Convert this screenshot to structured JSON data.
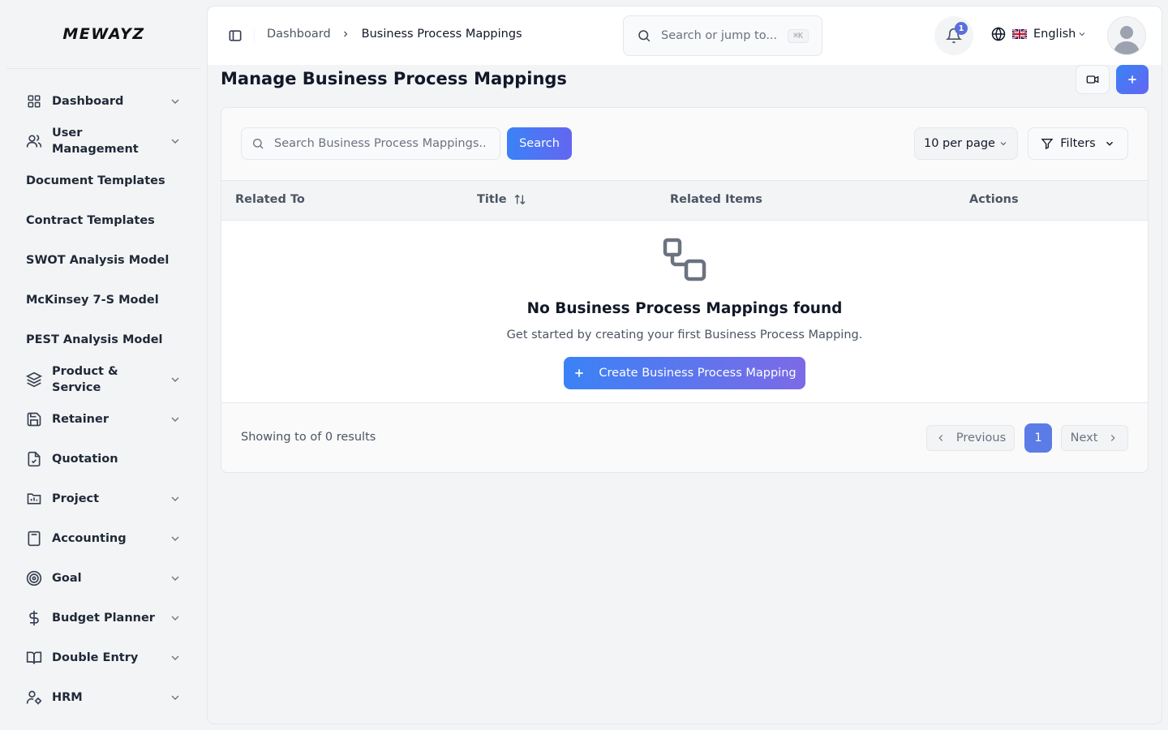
{
  "brand": {
    "logo_text": "MEWAYZ"
  },
  "sidebar": {
    "items": [
      {
        "label": "Dashboard",
        "icon": "grid-icon",
        "expandable": true
      },
      {
        "label": "User Management",
        "icon": "users-icon",
        "expandable": true
      },
      {
        "label": "Document Templates",
        "icon": "",
        "expandable": false
      },
      {
        "label": "Contract Templates",
        "icon": "",
        "expandable": false
      },
      {
        "label": "SWOT Analysis Model",
        "icon": "",
        "expandable": false
      },
      {
        "label": "McKinsey 7-S Model",
        "icon": "",
        "expandable": false
      },
      {
        "label": "PEST Analysis Model",
        "icon": "",
        "expandable": false
      },
      {
        "label": "Product & Service",
        "icon": "layers-icon",
        "expandable": true
      },
      {
        "label": "Retainer",
        "icon": "save-icon",
        "expandable": true
      },
      {
        "label": "Quotation",
        "icon": "file-check-icon",
        "expandable": false
      },
      {
        "label": "Project",
        "icon": "project-chart-icon",
        "expandable": true
      },
      {
        "label": "Accounting",
        "icon": "calculator-icon",
        "expandable": true
      },
      {
        "label": "Goal",
        "icon": "target-icon",
        "expandable": true
      },
      {
        "label": "Budget Planner",
        "icon": "dollar-icon",
        "expandable": true
      },
      {
        "label": "Double Entry",
        "icon": "book-open-icon",
        "expandable": true
      },
      {
        "label": "HRM",
        "icon": "user-cog-icon",
        "expandable": true
      }
    ]
  },
  "header": {
    "breadcrumb": [
      "Dashboard",
      "Business Process Mappings"
    ],
    "search_placeholder": "Search or jump to...",
    "search_shortcut": "⌘K",
    "notification_count": "1",
    "language": "English"
  },
  "page": {
    "title": "Manage Business Process Mappings"
  },
  "toolbar": {
    "search_placeholder": "Search Business Process Mappings...",
    "search_button": "Search",
    "per_page": "10 per page",
    "filters_label": "Filters"
  },
  "table": {
    "columns": [
      "Related To",
      "Title",
      "Related Items",
      "Actions"
    ],
    "rows": []
  },
  "empty_state": {
    "title": "No Business Process Mappings found",
    "subtitle": "Get started by creating your first Business Process Mapping.",
    "button": "Create Business Process Mapping"
  },
  "pagination": {
    "summary": "Showing to of 0 results",
    "previous": "Previous",
    "current_page": "1",
    "next": "Next"
  },
  "colors": {
    "accent": "#3b82f6",
    "accent_end": "#6366f1",
    "page_active": "#5b7be6",
    "badge": "#5b6fd8"
  }
}
